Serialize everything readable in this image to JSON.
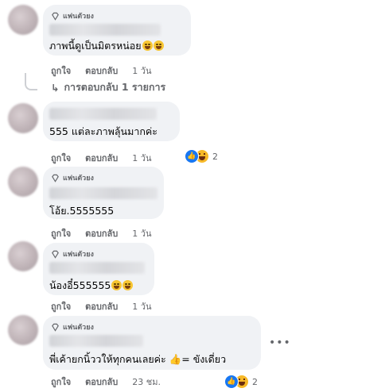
{
  "badge_label": "แฟนตัวยง",
  "actions": {
    "like": "ถูกใจ",
    "reply": "ตอบกลับ"
  },
  "comments": [
    {
      "text": "ภาพนี้ดูเป็นมิตรหน่อย",
      "time": "1 วัน",
      "has_badge": true,
      "emojis": 2
    },
    {
      "text": "555 แต่ละภาพลุ้นมากค่ะ",
      "time": "1 วัน",
      "has_badge": false,
      "reaction_count": "2"
    },
    {
      "text": "โอ้ย.5555555",
      "time": "1 วัน",
      "has_badge": true
    },
    {
      "text": "น้องอี๋555555",
      "time": "1 วัน",
      "has_badge": true,
      "emojis": 2
    },
    {
      "text": "พี่เค้ายกนิ้ววให้ทุกคนเลยค่ะ 👍= ขังเดี่ยว",
      "time": "23 ชม.",
      "has_badge": true,
      "reaction_count": "2"
    }
  ],
  "replies_link": "การตอบกลับ 1 รายการ",
  "more_icon": "more-options-icon",
  "colors": {
    "bubble": "#f0f2f5",
    "like": "#1877f2",
    "muted": "#65676b"
  }
}
